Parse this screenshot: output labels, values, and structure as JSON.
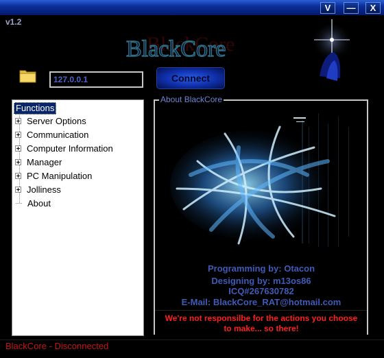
{
  "window": {
    "title_buttons": [
      "V",
      "—",
      "X"
    ],
    "version": "v1.2"
  },
  "logo": {
    "text": "BlackCore"
  },
  "connection": {
    "address": "127.0.0.1",
    "connect_label": "Connect"
  },
  "tree": {
    "root": "Functions",
    "items": [
      {
        "label": "Server Options",
        "expandable": true
      },
      {
        "label": "Communication",
        "expandable": true
      },
      {
        "label": "Computer Information",
        "expandable": true
      },
      {
        "label": "Manager",
        "expandable": true
      },
      {
        "label": "PC Manipulation",
        "expandable": true
      },
      {
        "label": "Jolliness",
        "expandable": true
      },
      {
        "label": "About",
        "expandable": false
      }
    ]
  },
  "about": {
    "title": "About BlackCore",
    "programming": "Programming by: Otacon",
    "designing": "Designing by: m13os86",
    "icq": "ICQ#267630782",
    "email": "E-Mail:  BlackCore_RAT@hotmail.com",
    "warning_line1": "We're not responsilbe for the actions you choose",
    "warning_line2": "to make... so there!"
  },
  "status": {
    "text": "BlackCore - Disconnected"
  },
  "colors": {
    "accent": "#3f5bb6",
    "warning": "#ff1e1e",
    "status": "#c41616"
  }
}
